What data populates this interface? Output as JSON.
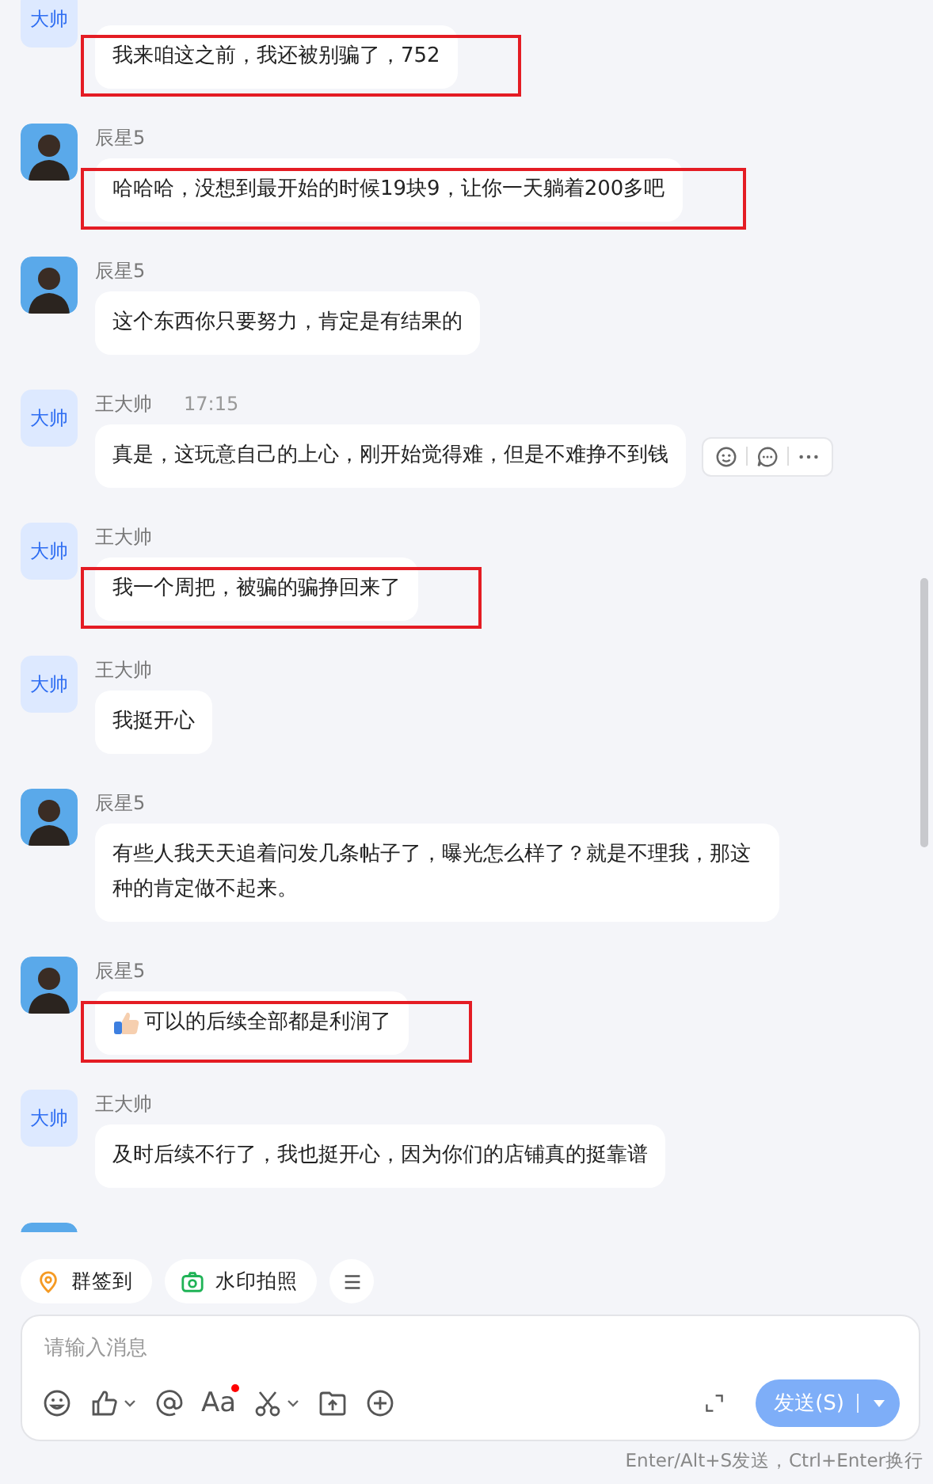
{
  "messages": [
    {
      "avatar": {
        "kind": "text",
        "label": "大帅"
      },
      "text": "我来咱这之前，我还被别骗了，752",
      "highlighted": true,
      "actions": false
    },
    {
      "avatar": {
        "kind": "photo"
      },
      "name": "辰星5",
      "text": "哈哈哈，没想到最开始的时候19块9，让你一天躺着200多吧",
      "highlighted": true,
      "actions": false
    },
    {
      "avatar": {
        "kind": "photo"
      },
      "name": "辰星5",
      "text": "这个东西你只要努力，肯定是有结果的",
      "highlighted": false,
      "actions": false
    },
    {
      "avatar": {
        "kind": "text",
        "label": "大帅"
      },
      "name": "王大帅",
      "time": "17:15",
      "text": "真是，这玩意自己的上心，刚开始觉得难，但是不难挣不到钱",
      "highlighted": false,
      "actions": true
    },
    {
      "avatar": {
        "kind": "text",
        "label": "大帅"
      },
      "name": "王大帅",
      "text": "我一个周把，被骗的骗挣回来了",
      "highlighted": true,
      "actions": false
    },
    {
      "avatar": {
        "kind": "text",
        "label": "大帅"
      },
      "name": "王大帅",
      "text": "我挺开心",
      "highlighted": false,
      "actions": false
    },
    {
      "avatar": {
        "kind": "photo"
      },
      "name": "辰星5",
      "text": "有些人我天天追着问发几条帖子了，曝光怎么样了？就是不理我，那这种的肯定做不起来。",
      "highlighted": false,
      "actions": false
    },
    {
      "avatar": {
        "kind": "photo"
      },
      "name": "辰星5",
      "text": "可以的后续全部都是利润了",
      "has_emoji": true,
      "highlighted": true,
      "actions": false
    },
    {
      "avatar": {
        "kind": "text",
        "label": "大帅"
      },
      "name": "王大帅",
      "text": "及时后续不行了，我也挺开心，因为你们的店铺真的挺靠谱",
      "highlighted": false,
      "actions": false
    },
    {
      "avatar": {
        "kind": "photo"
      }
    }
  ],
  "quick_actions": [
    {
      "kind": "checkin",
      "label": "群签到"
    },
    {
      "kind": "camera",
      "label": "水印拍照"
    },
    {
      "kind": "menu"
    }
  ],
  "composer": {
    "placeholder": "请输入消息",
    "toolbar": [
      {
        "kind": "emoji"
      },
      {
        "kind": "like",
        "dropdown": true
      },
      {
        "kind": "mention"
      },
      {
        "kind": "font",
        "label": "Aa",
        "dot": true
      },
      {
        "kind": "scissors",
        "dropdown": true
      },
      {
        "kind": "upload"
      },
      {
        "kind": "plus"
      }
    ],
    "send_label": "发送(S)",
    "hint": "Enter/Alt+S发送，Ctrl+Enter换行"
  }
}
